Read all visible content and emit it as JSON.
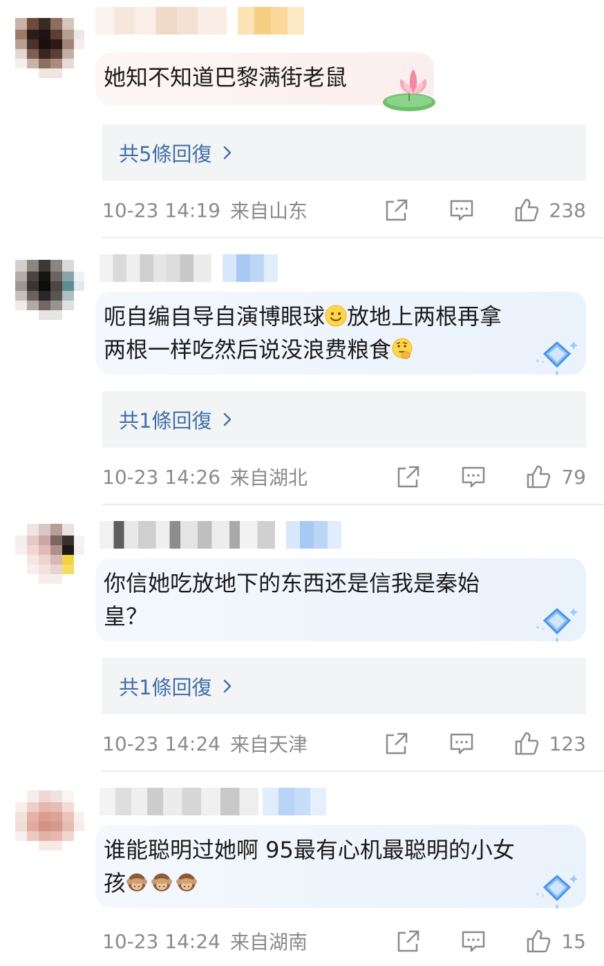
{
  "comments": [
    {
      "text_lines": [
        "她知不知道巴黎满街老鼠"
      ],
      "replies": "共5條回復",
      "time": "10-23 14:19",
      "location": "来自山东",
      "likes": "238"
    },
    {
      "text_lines": [
        "呃自编自导自演博眼球",
        "放地上两根再拿",
        "两根一样吃然后说没浪费粮食"
      ],
      "replies": "共1條回復",
      "time": "10-23 14:26",
      "location": "来自湖北",
      "likes": "79"
    },
    {
      "text_lines": [
        "你信她吃放地下的东西还是信我是秦始",
        "皇？"
      ],
      "replies": "共1條回復",
      "time": "10-23 14:24",
      "location": "来自天津",
      "likes": "123"
    },
    {
      "text_lines": [
        "谁能聪明过她啊 95最有心机最聪明的小女",
        "孩"
      ],
      "replies": "",
      "time": "10-23 14:24",
      "location": "来自湖南",
      "likes": "15"
    }
  ],
  "icons": {
    "share": "share-icon",
    "comment": "comment-icon",
    "like": "thumbs-up-icon",
    "emoji_smile": "smile-emoji",
    "emoji_think": "thinking-emoji",
    "emoji_monkey": "see-no-evil-monkey-emoji",
    "decor_lotus": "lotus-icon",
    "decor_diamond": "diamond-icon"
  },
  "colors": {
    "reply_link": "#3f6fa8",
    "meta_text": "#8a8a8a",
    "reply_box_bg": "#f3f4f6",
    "bubble_pink": "#fbeeee",
    "bubble_blue": "#eaf2fc"
  }
}
